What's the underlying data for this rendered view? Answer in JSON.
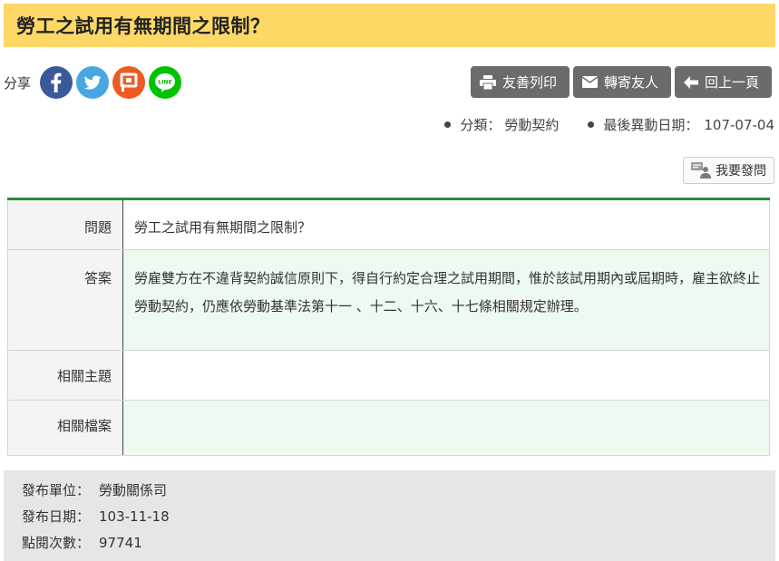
{
  "page": {
    "title": "勞工之試用有無期間之限制？"
  },
  "share": {
    "label": "分享",
    "icons": [
      "facebook-icon",
      "twitter-icon",
      "plurk-icon",
      "line-icon"
    ],
    "colors": {
      "facebook": "#3b5998",
      "twitter": "#48a7e0",
      "plurk": "#f05a22",
      "line": "#00c300"
    },
    "line_text": "LINE"
  },
  "actions": {
    "print_label": "友善列印",
    "forward_label": "轉寄友人",
    "back_label": "回上一頁"
  },
  "meta": {
    "category_label": "分類：",
    "category_value": "勞動契約",
    "updated_label": "最後異動日期：",
    "updated_value": "107-07-04"
  },
  "ask_button": {
    "label": "我要發問"
  },
  "qa": {
    "question_label": "問題",
    "question_text": "勞工之試用有無期間之限制？",
    "answer_label": "答案",
    "answer_text": "勞雇雙方在不違背契約誠信原則下，得自行約定合理之試用期間，惟於該試用期內或屆期時，雇主欲終止勞動契約，仍應依勞動基準法第十一 、十二、十六、十七條相關規定辦理。",
    "related_topics_label": "相關主題",
    "related_topics_value": "",
    "related_files_label": "相關檔案",
    "related_files_value": ""
  },
  "footer": {
    "unit_label": "發布單位：",
    "unit_value": "勞動關係司",
    "date_label": "發布日期：",
    "date_value": "103-11-18",
    "views_label": "點閱次數：",
    "views_value": "97741"
  },
  "colors": {
    "title_bar": "#fdd867",
    "table_accent": "#2b8a3e",
    "answer_bg": "#edfaef",
    "button_bg": "#6b6b6b",
    "footer_bg": "#e6e6e6"
  }
}
